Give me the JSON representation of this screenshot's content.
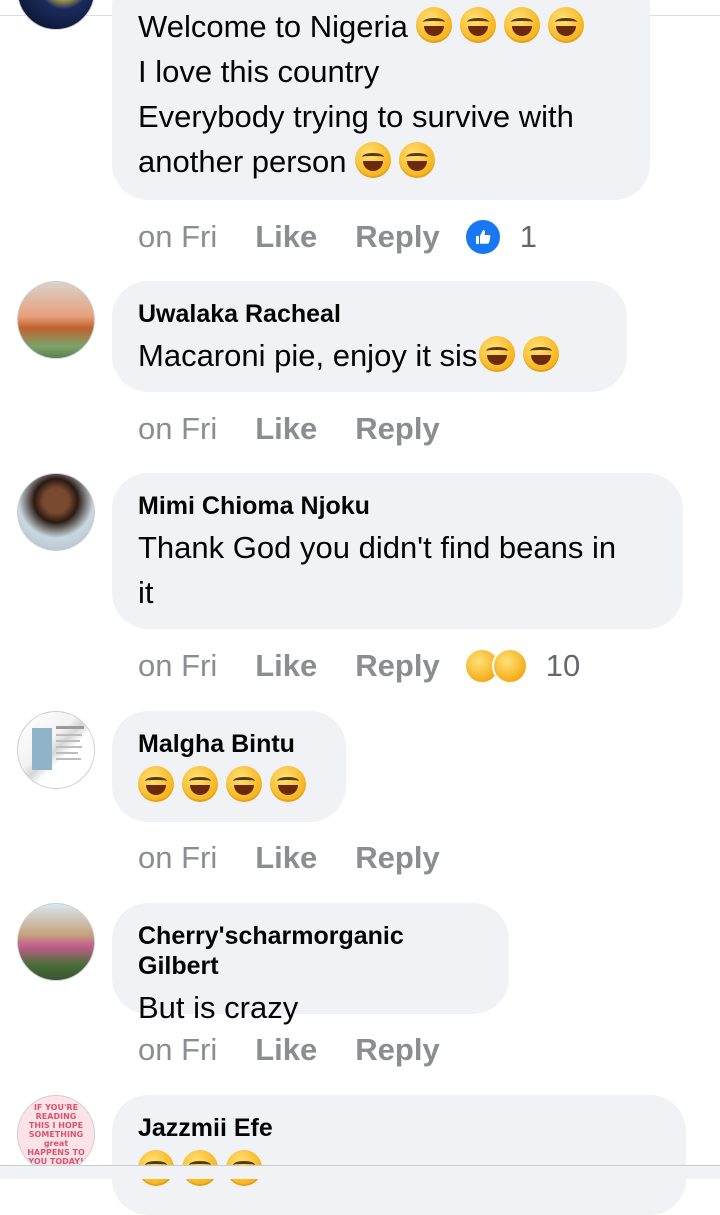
{
  "comments": [
    {
      "name": "",
      "text_lines": [
        "Welcome to Nigeria",
        "I love this country",
        "Everybody trying to survive with",
        "another person"
      ],
      "emoji_line0": [
        "rolling-laughing",
        "rolling-laughing",
        "rolling-laughing",
        "rolling-laughing"
      ],
      "emoji_line3": [
        "rolling-laughing",
        "rolling-laughing"
      ],
      "time": "on Fri",
      "like_label": "Like",
      "reply_label": "Reply",
      "reaction_icons": [
        "like-icon"
      ],
      "reaction_count": "1"
    },
    {
      "name": "Uwalaka Racheal",
      "text": "Macaroni pie, enjoy it sis",
      "emojis": [
        "tears-of-joy",
        "tears-of-joy"
      ],
      "time": "on Fri",
      "like_label": "Like",
      "reply_label": "Reply"
    },
    {
      "name": "Mimi Chioma Njoku",
      "text_lines": [
        "Thank God you didn't find beans in",
        "it"
      ],
      "time": "on Fri",
      "like_label": "Like",
      "reply_label": "Reply",
      "reaction_icons": [
        "haha-icon",
        "sad-icon"
      ],
      "reaction_count": "10"
    },
    {
      "name": "Malgha Bintu",
      "emojis": [
        "tears-of-joy",
        "tears-of-joy",
        "tears-of-joy",
        "tears-of-joy"
      ],
      "time": "on Fri",
      "like_label": "Like",
      "reply_label": "Reply"
    },
    {
      "name": "Cherry'scharmorganic Gilbert",
      "text": "But is crazy",
      "time": "on Fri",
      "like_label": "Like",
      "reply_label": "Reply"
    },
    {
      "name": "Jazzmii Efe",
      "emojis": [
        "tears-of-joy",
        "rolling-laughing",
        "sweat-smile"
      ],
      "avatar_text": "IF YOU'RE READING THIS I HOPE SOMETHING great HAPPENS TO YOU TODAY!"
    }
  ],
  "colors": {
    "bubble": "#f0f2f5",
    "meta": "#8a8d91",
    "like_blue": "#1877f2"
  }
}
